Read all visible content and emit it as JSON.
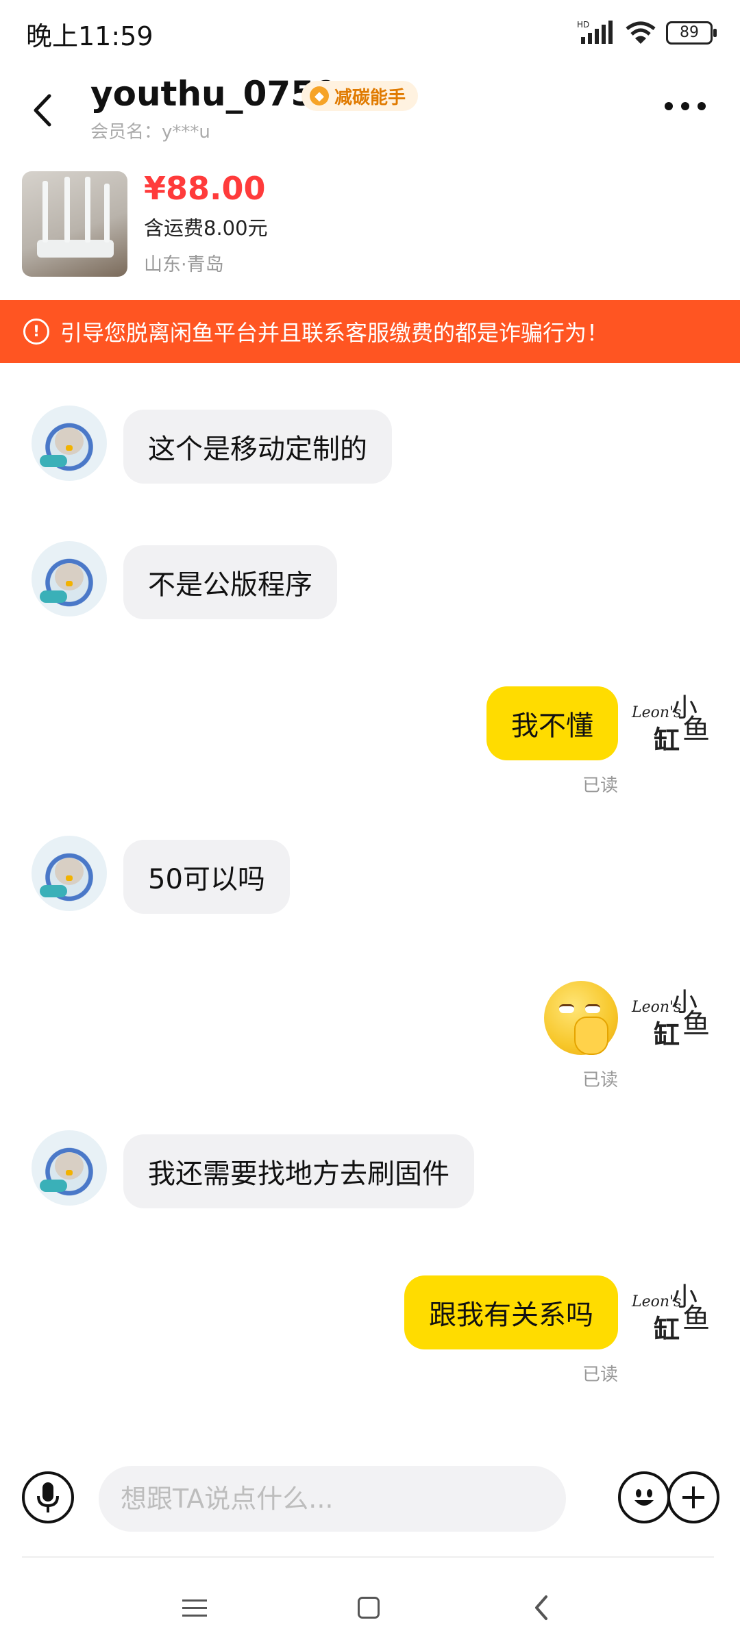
{
  "status_bar": {
    "time": "晚上11:59",
    "network_label": "HD",
    "battery": "89"
  },
  "header": {
    "title": "youthu_0759",
    "badge": "减碳能手",
    "member_label": "会员名：",
    "member_name": "y***u"
  },
  "product": {
    "price": "¥88.00",
    "shipping": "含运费8.00元",
    "location": "山东·青岛"
  },
  "warning": {
    "text": "引导您脱离闲鱼平台并且联系客服缴费的都是诈骗行为！"
  },
  "my_avatar": {
    "sig": "Leon's",
    "xiao": "小",
    "yu": "鱼",
    "gang": "缸"
  },
  "messages": [
    {
      "side": "left",
      "text": "这个是移动定制的"
    },
    {
      "side": "left",
      "text": "不是公版程序"
    },
    {
      "side": "right",
      "text": "我不懂",
      "status": "已读"
    },
    {
      "side": "left",
      "text": "50可以吗"
    },
    {
      "side": "right",
      "type": "emoji",
      "emoji": "smirking-hand-over-mouth",
      "status": "已读"
    },
    {
      "side": "left",
      "text": "我还需要找地方去刷固件"
    },
    {
      "side": "right",
      "text": "跟我有关系吗",
      "status": "已读"
    }
  ],
  "input": {
    "placeholder": "想跟TA说点什么..."
  },
  "icons": {
    "back": "back-arrow-icon",
    "more": "more-dots-icon",
    "mic": "microphone-icon",
    "emoji": "smiley-icon",
    "plus": "plus-icon"
  },
  "colors": {
    "price": "#ff3b3b",
    "warning_bg": "#ff5522",
    "my_bubble": "#ffdc00",
    "their_bubble": "#f1f1f3"
  }
}
